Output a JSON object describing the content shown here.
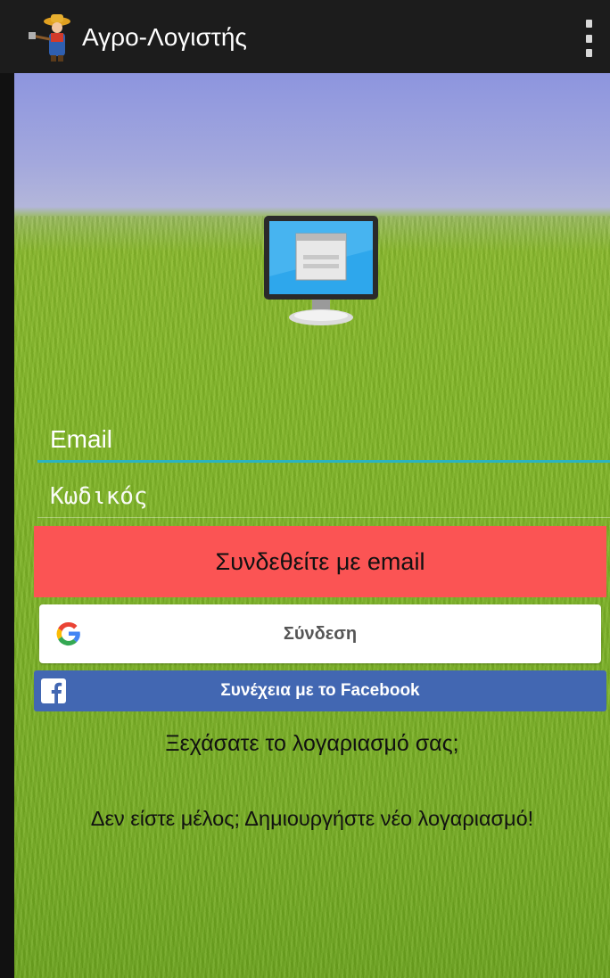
{
  "app_bar": {
    "title": "Αγρο-Λογιστής",
    "logo_icon": "farmer-logo-icon",
    "menu_icon": "overflow-menu-icon"
  },
  "login_form": {
    "email_placeholder": "Email",
    "password_placeholder": "Κωδικός",
    "email_login_label": "Συνδεθείτε με email",
    "google_label": "Σύνδεση",
    "facebook_label": "Συνέχεια με το Facebook",
    "forgot_account_label": "Ξεχάσατε το λογαριασμό σας;",
    "register_label": "Δεν είστε μέλος; Δημιουργήστε νέο λογαριασμό!"
  },
  "colors": {
    "app_bar_bg": "#1c1c1c",
    "email_login_bg": "#fb5454",
    "facebook_bg": "#4267b2",
    "input_focus_underline": "#2bb3c0"
  }
}
